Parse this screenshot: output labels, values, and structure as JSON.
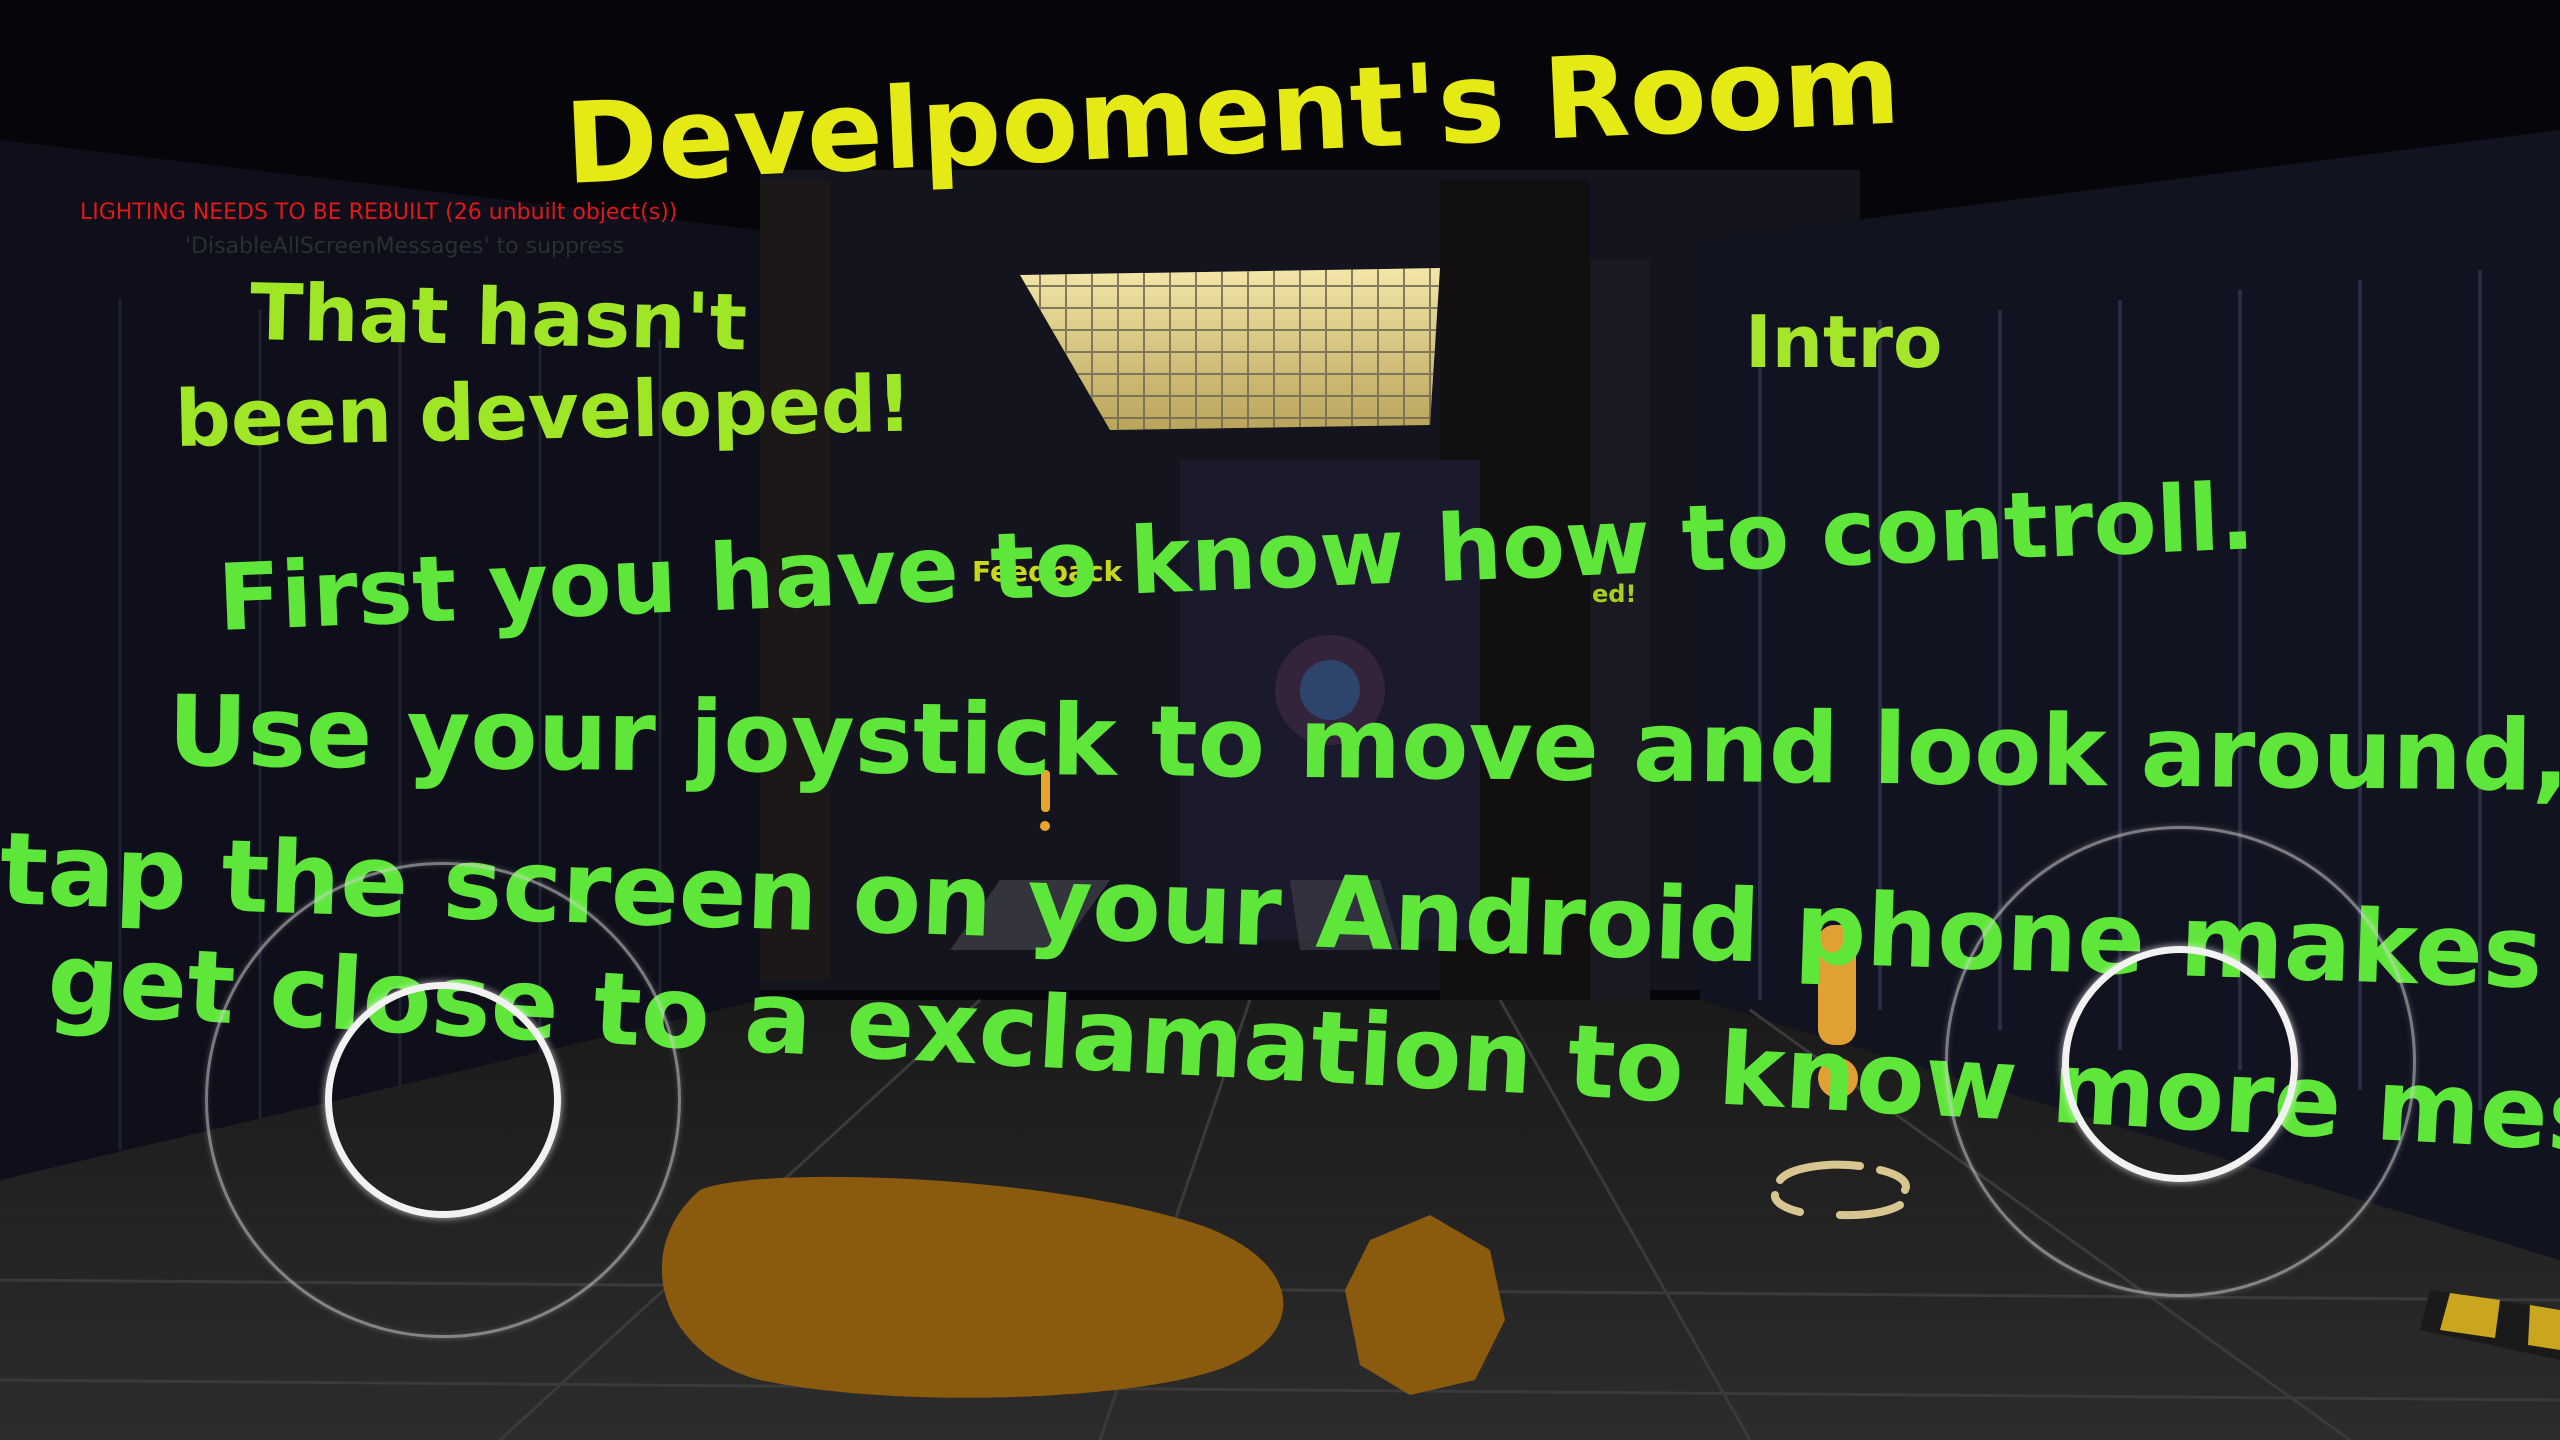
{
  "scene": {
    "room_title": "Develpoment's Room",
    "undeveloped_sign": [
      "That hasn't",
      "been developed!"
    ],
    "intro_sign": "Intro",
    "feedback_sign": "Feedback",
    "partial_sign": "ed!"
  },
  "tutorial_lines": [
    "First you have to know how to controll.",
    "Use your joystick to move and look around,",
    "tap the screen on your Android phone makes you jump,",
    "get close to a exclamation to know more message"
  ],
  "debug": {
    "message": "LIGHTING NEEDS TO BE REBUILT (26 unbuilt object(s))",
    "hint": "'DisableAllScreenMessages' to suppress"
  },
  "colors": {
    "title": "#e6ea14",
    "sign_green": "#9ee626",
    "tutorial_green": "#5fe63a",
    "debug_red": "#e01818"
  },
  "controls": {
    "left_stick": "move-joystick",
    "right_stick": "look-joystick"
  }
}
